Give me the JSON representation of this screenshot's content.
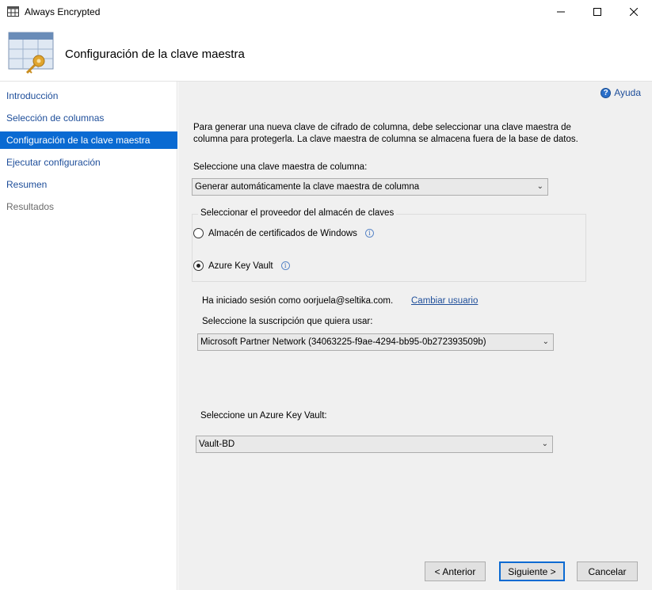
{
  "window": {
    "title": "Always Encrypted"
  },
  "header": {
    "title": "Configuración de la clave maestra"
  },
  "nav": {
    "items": [
      {
        "label": "Introducción"
      },
      {
        "label": "Selección de columnas"
      },
      {
        "label": "Configuración de la clave maestra"
      },
      {
        "label": "Ejecutar configuración"
      },
      {
        "label": "Resumen"
      },
      {
        "label": "Resultados"
      }
    ]
  },
  "main": {
    "help_label": "Ayuda",
    "description": "Para generar una nueva clave de cifrado de columna, debe seleccionar una clave maestra de columna para protegerla.  La clave maestra de columna se almacena fuera de la base de datos.",
    "master_key_label": "Seleccione una clave maestra de columna:",
    "master_key_value": "Generar automáticamente la clave maestra de columna",
    "provider_group_label": "Seleccionar el proveedor del almacén de claves",
    "provider_options": [
      {
        "label": "Almacén de certificados de Windows",
        "selected": false
      },
      {
        "label": "Azure Key Vault",
        "selected": true
      }
    ],
    "signed_in_text": "Ha iniciado sesión como oorjuela@seltika.com.",
    "change_user_label": "Cambiar usuario",
    "subscription_label": "Seleccione la suscripción que quiera usar:",
    "subscription_value": "Microsoft Partner Network (34063225-f9ae-4294-bb95-0b272393509b)",
    "vault_label": "Seleccione un Azure Key Vault:",
    "vault_value": "Vault-BD"
  },
  "buttons": {
    "back": "< Anterior",
    "next": "Siguiente >",
    "cancel": "Cancelar"
  },
  "colors": {
    "accent": "#0a6ad2",
    "link": "#1e4e9a",
    "panel": "#f0f0f0"
  }
}
